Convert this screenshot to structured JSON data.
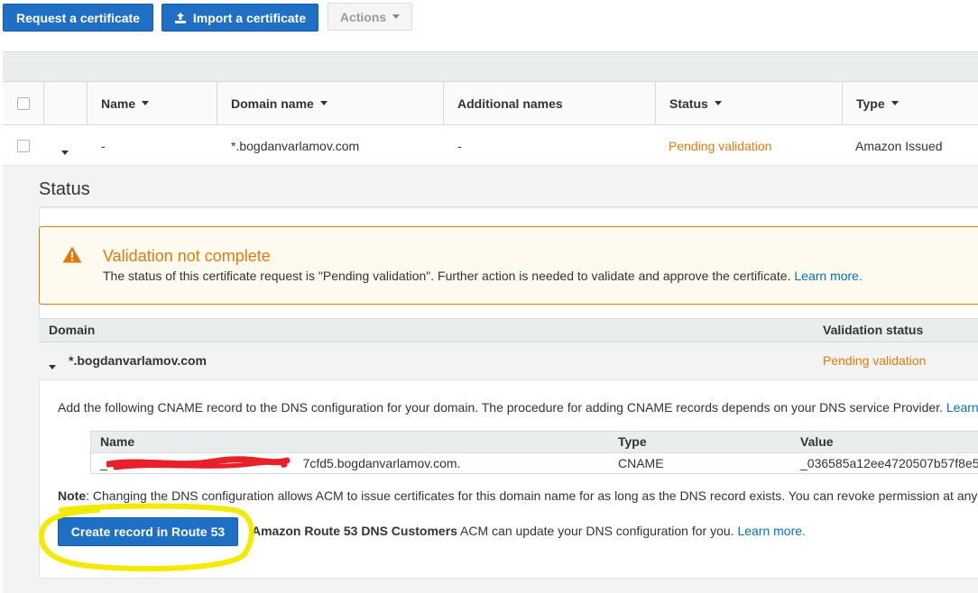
{
  "toolbar": {
    "request_label": "Request a certificate",
    "import_label": "Import a certificate",
    "actions_label": "Actions"
  },
  "table": {
    "columns": [
      "Name",
      "Domain name",
      "Additional names",
      "Status",
      "Type"
    ],
    "rows": [
      {
        "name": "-",
        "domain": "*.bogdanvarlamov.com",
        "additional": "-",
        "status": "Pending validation",
        "type": "Amazon Issued"
      }
    ]
  },
  "detail": {
    "section_title": "Status",
    "alert": {
      "title": "Validation not complete",
      "message": "The status of this certificate request is \"Pending validation\". Further action is needed to validate and approve the certificate.",
      "link": "Learn more."
    },
    "domain_table": {
      "col_domain": "Domain",
      "col_status": "Validation status",
      "domain": "*.bogdanvarlamov.com",
      "status": "Pending validation"
    },
    "cname_instructions": "Add the following CNAME record to the DNS configuration for your domain. The procedure for adding CNAME records depends on your DNS service Provider.",
    "cname_instructions_link": "Learn",
    "cname_table": {
      "col_name": "Name",
      "col_type": "Type",
      "col_value": "Value",
      "name_visible_prefix": "_",
      "name_visible_suffix": "7cfd5.bogdanvarlamov.com.",
      "type": "CNAME",
      "value": "_036585a12ee4720507b57f8e5"
    },
    "note_label": "Note",
    "note_text": ": Changing the DNS configuration allows ACM to issue certificates for this domain name for as long as the DNS record exists. You can revoke permission at any",
    "route53_button": "Create record in Route 53",
    "route53_bold": "Amazon Route 53 DNS Customers",
    "route53_text": " ACM can update your DNS configuration for you.",
    "route53_link": "Learn more."
  },
  "colors": {
    "primary": "#1f6fc5",
    "pending": "#e07b0f",
    "link": "#0073bb",
    "highlight_annotation": "#f2ea00",
    "redaction": "#e8202a"
  }
}
